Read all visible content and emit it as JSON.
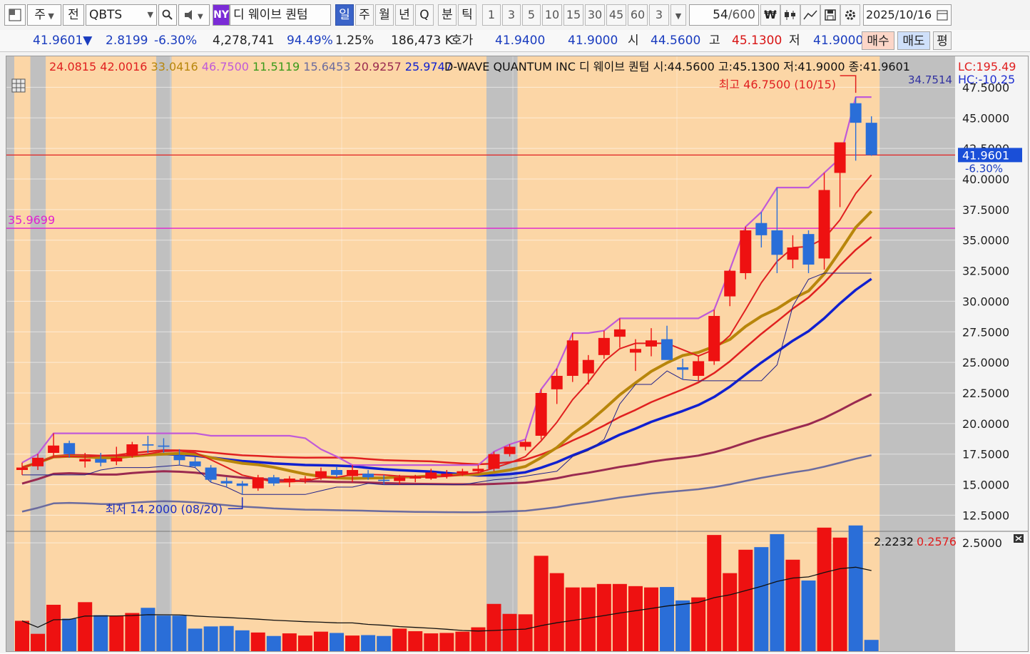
{
  "toolbar": {
    "period_week": "주",
    "prev_label": "전",
    "symbol": "QBTS",
    "exchange": "NY",
    "name": "디 웨이브 퀀텀",
    "tabs": [
      "일",
      "주",
      "월",
      "년",
      "Q",
      "분",
      "틱"
    ],
    "intervals": [
      "1",
      "3",
      "5",
      "10",
      "15",
      "30",
      "45",
      "60",
      "3"
    ],
    "count": "54",
    "count_total": "/600",
    "date": "2025/10/16"
  },
  "quote": {
    "price": "41.9601▼",
    "change": "2.8199",
    "change_pct": "-6.30%",
    "volume": "4,278,741",
    "vol_ratio": "94.49%",
    "turnover": "1.25%",
    "amount": "186,473 K",
    "bid_label": "호가",
    "bid": "41.9400",
    "ask": "41.9000",
    "open_label": "시",
    "open": "44.5600",
    "high_label": "고",
    "high": "45.1300",
    "low_label": "저",
    "low": "41.9000",
    "buy_label": "매수",
    "sell_label": "매도",
    "eval_label": "평"
  },
  "chart_data": {
    "type": "candlestick",
    "title": "D-WAVE QUANTUM INC  디 웨이브 퀀텀 시:44.5600 고:45.1300 저:41.9000 종:41.9601",
    "ma_values": [
      {
        "value": "24.0815",
        "color": "#e02020"
      },
      {
        "value": "42.0016",
        "color": "#e02020"
      },
      {
        "value": "33.0416",
        "color": "#b8860b"
      },
      {
        "value": "46.7500",
        "color": "#c05ad8"
      },
      {
        "value": "11.5119",
        "color": "#3a9a1a"
      },
      {
        "value": "15.6453",
        "color": "#6b6b9e"
      },
      {
        "value": "20.9257",
        "color": "#9a2a50"
      },
      {
        "value": "25.9747",
        "color": "#1020d0"
      }
    ],
    "limit_up": "LC:195.49",
    "limit_down": "HC:-10.25",
    "upper_line_value": "34.7514",
    "high_annotation": "최고 46.7500 (10/15)",
    "low_annotation": "최저 14.2000 (08/20)",
    "hline_value": "35.9699",
    "last_price": "41.9601",
    "last_change": "-6.30%",
    "y_ticks": [
      "47.5000",
      "45.0000",
      "42.5000",
      "40.0000",
      "37.5000",
      "35.0000",
      "32.5000",
      "30.0000",
      "27.5000",
      "25.0000",
      "22.5000",
      "20.0000",
      "17.5000",
      "15.0000",
      "12.5000"
    ],
    "ylim": [
      11.3,
      47.7
    ],
    "volume_header": [
      "2.2232",
      "0.2576"
    ],
    "volume_tick": "2.5000",
    "volume_max": 2.6,
    "candles": [
      {
        "o": 16.2,
        "h": 16.8,
        "l": 15.8,
        "c": 16.4
      },
      {
        "o": 16.5,
        "h": 17.5,
        "l": 16.2,
        "c": 17.2
      },
      {
        "o": 17.6,
        "h": 19.2,
        "l": 17.3,
        "c": 18.2
      },
      {
        "o": 18.4,
        "h": 18.6,
        "l": 17.2,
        "c": 17.5
      },
      {
        "o": 16.9,
        "h": 17.6,
        "l": 16.4,
        "c": 17.1
      },
      {
        "o": 17.1,
        "h": 17.6,
        "l": 16.5,
        "c": 16.8
      },
      {
        "o": 16.9,
        "h": 18.1,
        "l": 16.6,
        "c": 17.2
      },
      {
        "o": 17.4,
        "h": 18.5,
        "l": 17.2,
        "c": 18.3
      },
      {
        "o": 18.3,
        "h": 19.0,
        "l": 17.6,
        "c": 18.2
      },
      {
        "o": 18.2,
        "h": 18.8,
        "l": 17.6,
        "c": 18.1
      },
      {
        "o": 17.4,
        "h": 17.9,
        "l": 16.6,
        "c": 17.0
      },
      {
        "o": 16.9,
        "h": 17.3,
        "l": 16.4,
        "c": 16.5
      },
      {
        "o": 16.4,
        "h": 16.6,
        "l": 15.2,
        "c": 15.4
      },
      {
        "o": 15.3,
        "h": 15.6,
        "l": 14.8,
        "c": 15.1
      },
      {
        "o": 15.1,
        "h": 15.3,
        "l": 14.2,
        "c": 14.9
      },
      {
        "o": 14.7,
        "h": 15.8,
        "l": 14.5,
        "c": 15.6
      },
      {
        "o": 15.6,
        "h": 15.8,
        "l": 14.9,
        "c": 15.1
      },
      {
        "o": 15.2,
        "h": 15.7,
        "l": 14.8,
        "c": 15.5
      },
      {
        "o": 15.4,
        "h": 15.7,
        "l": 15.1,
        "c": 15.5
      },
      {
        "o": 15.6,
        "h": 16.4,
        "l": 15.4,
        "c": 16.1
      },
      {
        "o": 16.2,
        "h": 16.5,
        "l": 15.6,
        "c": 15.8
      },
      {
        "o": 15.7,
        "h": 16.6,
        "l": 15.2,
        "c": 16.2
      },
      {
        "o": 15.9,
        "h": 16.2,
        "l": 15.4,
        "c": 15.6
      },
      {
        "o": 15.4,
        "h": 15.8,
        "l": 15.0,
        "c": 15.3
      },
      {
        "o": 15.3,
        "h": 15.8,
        "l": 15.0,
        "c": 15.6
      },
      {
        "o": 15.5,
        "h": 15.8,
        "l": 15.2,
        "c": 15.6
      },
      {
        "o": 15.5,
        "h": 16.3,
        "l": 15.4,
        "c": 16.0
      },
      {
        "o": 15.7,
        "h": 16.2,
        "l": 15.5,
        "c": 15.9
      },
      {
        "o": 15.9,
        "h": 16.3,
        "l": 15.7,
        "c": 16.1
      },
      {
        "o": 16.1,
        "h": 16.6,
        "l": 15.9,
        "c": 16.3
      },
      {
        "o": 16.3,
        "h": 17.7,
        "l": 16.1,
        "c": 17.5
      },
      {
        "o": 17.5,
        "h": 18.3,
        "l": 17.3,
        "c": 18.1
      },
      {
        "o": 18.1,
        "h": 18.7,
        "l": 17.8,
        "c": 18.5
      },
      {
        "o": 19.0,
        "h": 22.8,
        "l": 18.7,
        "c": 22.5
      },
      {
        "o": 22.8,
        "h": 24.5,
        "l": 21.6,
        "c": 23.9
      },
      {
        "o": 23.9,
        "h": 27.4,
        "l": 23.4,
        "c": 26.8
      },
      {
        "o": 24.1,
        "h": 25.6,
        "l": 23.2,
        "c": 25.2
      },
      {
        "o": 25.6,
        "h": 27.6,
        "l": 25.3,
        "c": 27.0
      },
      {
        "o": 27.1,
        "h": 28.6,
        "l": 26.2,
        "c": 27.7
      },
      {
        "o": 25.8,
        "h": 26.9,
        "l": 24.3,
        "c": 26.1
      },
      {
        "o": 26.3,
        "h": 27.8,
        "l": 25.5,
        "c": 26.8
      },
      {
        "o": 26.9,
        "h": 28.0,
        "l": 25.6,
        "c": 25.2
      },
      {
        "o": 24.6,
        "h": 25.3,
        "l": 23.6,
        "c": 24.4
      },
      {
        "o": 23.9,
        "h": 25.6,
        "l": 23.5,
        "c": 25.1
      },
      {
        "o": 25.1,
        "h": 29.3,
        "l": 24.8,
        "c": 28.8
      },
      {
        "o": 30.4,
        "h": 32.6,
        "l": 29.6,
        "c": 32.5
      },
      {
        "o": 32.3,
        "h": 36.1,
        "l": 31.8,
        "c": 35.8
      },
      {
        "o": 36.4,
        "h": 37.3,
        "l": 34.4,
        "c": 35.4
      },
      {
        "o": 35.8,
        "h": 39.3,
        "l": 32.3,
        "c": 33.8
      },
      {
        "o": 33.4,
        "h": 35.4,
        "l": 32.7,
        "c": 34.4
      },
      {
        "o": 35.5,
        "h": 35.8,
        "l": 32.3,
        "c": 33.0
      },
      {
        "o": 33.5,
        "h": 40.5,
        "l": 32.6,
        "c": 39.1
      },
      {
        "o": 40.5,
        "h": 41.7,
        "l": 37.7,
        "c": 43.0
      },
      {
        "o": 46.2,
        "h": 46.7,
        "l": 41.5,
        "c": 44.6
      },
      {
        "o": 44.6,
        "h": 45.13,
        "l": 41.9,
        "c": 41.96
      }
    ],
    "volume": [
      0.7,
      0.4,
      1.07,
      0.75,
      1.13,
      0.83,
      0.81,
      0.88,
      1.0,
      0.82,
      0.82,
      0.52,
      0.57,
      0.58,
      0.48,
      0.43,
      0.35,
      0.41,
      0.36,
      0.45,
      0.42,
      0.36,
      0.37,
      0.35,
      0.52,
      0.46,
      0.41,
      0.42,
      0.45,
      0.55,
      1.09,
      0.86,
      0.85,
      2.2,
      1.8,
      1.47,
      1.47,
      1.55,
      1.55,
      1.5,
      1.47,
      1.48,
      1.17,
      1.24,
      2.68,
      1.8,
      2.34,
      2.4,
      2.7,
      2.11,
      1.63,
      2.85,
      2.62,
      2.9,
      0.26
    ]
  },
  "colors": {
    "up": "#ee1111",
    "down": "#2a6ed8",
    "shade": "#fcd6a6",
    "gap": "#c0c0c0"
  }
}
